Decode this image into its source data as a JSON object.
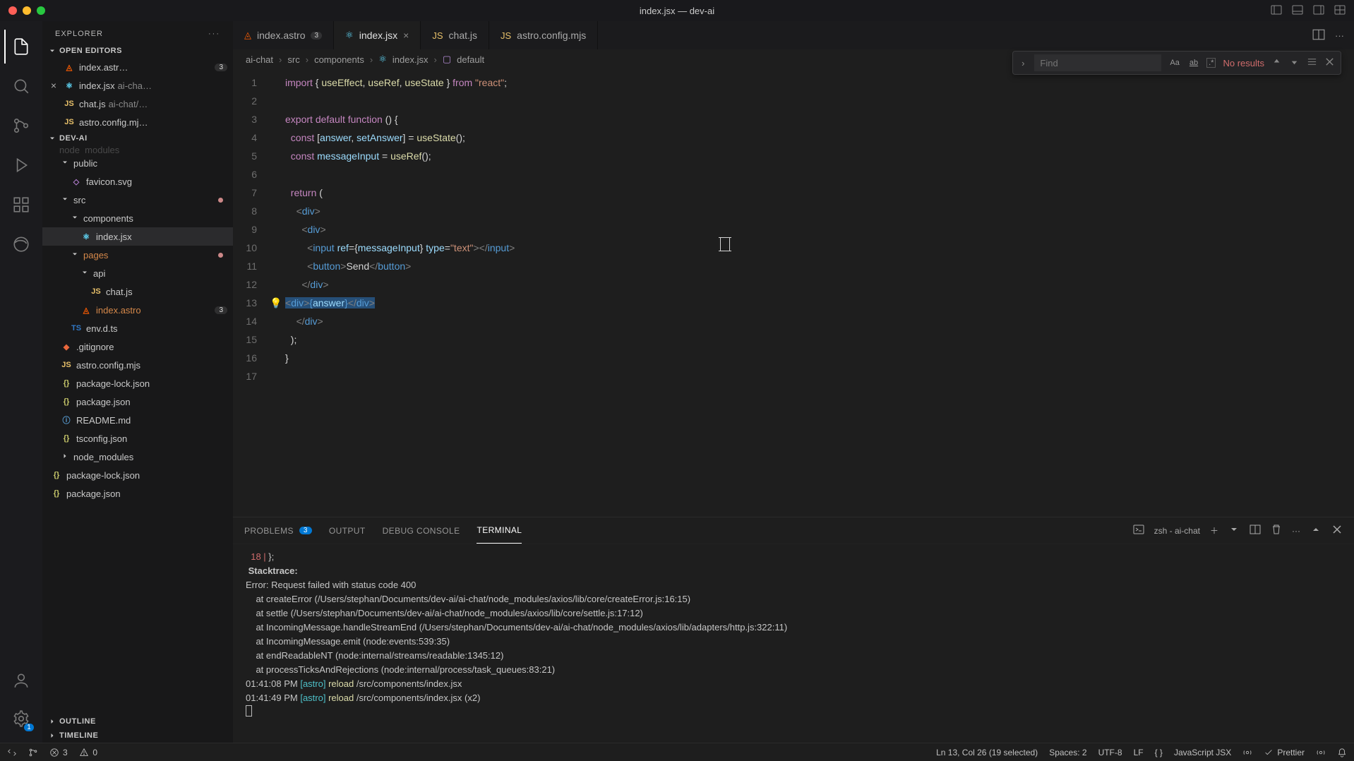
{
  "window": {
    "title": "index.jsx — dev-ai"
  },
  "explorer": {
    "title": "EXPLORER",
    "open_editors_label": "OPEN EDITORS",
    "project_label": "DEV-AI",
    "outline_label": "OUTLINE",
    "timeline_label": "TIMELINE",
    "open_editors": [
      {
        "name": "index.astr…",
        "icon": "astro",
        "badge": "3"
      },
      {
        "name": "index.jsx",
        "dim": "ai-cha…",
        "icon": "react",
        "close": true
      },
      {
        "name": "chat.js",
        "dim": "ai-chat/…",
        "icon": "js"
      },
      {
        "name": "astro.config.mj…",
        "icon": "js"
      }
    ],
    "tree": [
      {
        "depth": 1,
        "kind": "folder-open",
        "label": "public"
      },
      {
        "depth": 2,
        "kind": "file",
        "icon": "svg",
        "label": "favicon.svg"
      },
      {
        "depth": 1,
        "kind": "folder-open",
        "label": "src",
        "dot": true
      },
      {
        "depth": 2,
        "kind": "folder-open",
        "label": "components"
      },
      {
        "depth": 3,
        "kind": "file",
        "icon": "react",
        "label": "index.jsx",
        "selected": true
      },
      {
        "depth": 2,
        "kind": "folder-open",
        "label": "pages",
        "orange": true,
        "dot": true
      },
      {
        "depth": 3,
        "kind": "folder-open",
        "label": "api"
      },
      {
        "depth": 4,
        "kind": "file",
        "icon": "js",
        "label": "chat.js"
      },
      {
        "depth": 3,
        "kind": "file",
        "icon": "astro",
        "label": "index.astro",
        "orange": true,
        "badge": "3"
      },
      {
        "depth": 2,
        "kind": "file",
        "icon": "ts",
        "label": "env.d.ts"
      },
      {
        "depth": 1,
        "kind": "file",
        "icon": "git",
        "label": ".gitignore"
      },
      {
        "depth": 1,
        "kind": "file",
        "icon": "js",
        "label": "astro.config.mjs"
      },
      {
        "depth": 1,
        "kind": "file",
        "icon": "json",
        "label": "package-lock.json"
      },
      {
        "depth": 1,
        "kind": "file",
        "icon": "json",
        "label": "package.json"
      },
      {
        "depth": 1,
        "kind": "file",
        "icon": "info",
        "label": "README.md"
      },
      {
        "depth": 1,
        "kind": "file",
        "icon": "json",
        "label": "tsconfig.json"
      },
      {
        "depth": 1,
        "kind": "folder",
        "label": "node_modules"
      },
      {
        "depth": 0,
        "kind": "file",
        "icon": "json",
        "label": "package-lock.json"
      },
      {
        "depth": 0,
        "kind": "file",
        "icon": "json",
        "label": "package.json"
      }
    ]
  },
  "tabs": [
    {
      "icon": "astro",
      "label": "index.astro",
      "badge": "3",
      "active": false
    },
    {
      "icon": "react",
      "label": "index.jsx",
      "close": true,
      "active": true
    },
    {
      "icon": "js",
      "label": "chat.js",
      "active": false
    },
    {
      "icon": "js",
      "label": "astro.config.mjs",
      "active": false
    }
  ],
  "breadcrumb": [
    "ai-chat",
    "src",
    "components",
    "index.jsx",
    "default"
  ],
  "find": {
    "placeholder": "Find",
    "no_results": "No results",
    "case": "Aa",
    "word": "ab",
    "regex": ".*"
  },
  "code": {
    "lines": [
      "import { useEffect, useRef, useState } from \"react\";",
      "",
      "export default function () {",
      "  const [answer, setAnswer] = useState();",
      "  const messageInput = useRef();",
      "",
      "  return (",
      "    <div>",
      "      <div>",
      "        <input ref={messageInput} type=\"text\"></input>",
      "        <button>Send</button>",
      "      </div>",
      "      <div>{answer}</div>",
      "    </div>",
      "  );",
      "}",
      ""
    ],
    "highlight_line": 13
  },
  "panel": {
    "tabs": {
      "problems": "PROBLEMS",
      "problems_badge": "3",
      "output": "OUTPUT",
      "debug": "DEBUG CONSOLE",
      "terminal": "TERMINAL"
    },
    "shell_label": "zsh - ai-chat",
    "terminal_lines": [
      {
        "plain": "  18 | };",
        "red_prefix": true
      },
      {
        "bold": " Stacktrace:"
      },
      {
        "plain": "Error: Request failed with status code 400"
      },
      {
        "plain": "    at createError (/Users/stephan/Documents/dev-ai/ai-chat/node_modules/axios/lib/core/createError.js:16:15)"
      },
      {
        "plain": "    at settle (/Users/stephan/Documents/dev-ai/ai-chat/node_modules/axios/lib/core/settle.js:17:12)"
      },
      {
        "plain": "    at IncomingMessage.handleStreamEnd (/Users/stephan/Documents/dev-ai/ai-chat/node_modules/axios/lib/adapters/http.js:322:11)"
      },
      {
        "plain": "    at IncomingMessage.emit (node:events:539:35)"
      },
      {
        "plain": "    at endReadableNT (node:internal/streams/readable:1345:12)"
      },
      {
        "plain": "    at processTicksAndRejections (node:internal/process/task_queues:83:21)"
      },
      {
        "reload": true,
        "time": "01:41:08 PM",
        "tag": "[astro]",
        "action": "reload",
        "path": "/src/components/index.jsx"
      },
      {
        "reload": true,
        "time": "01:41:49 PM",
        "tag": "[astro]",
        "action": "reload",
        "path": "/src/components/index.jsx (x2)"
      }
    ]
  },
  "status": {
    "remote": "",
    "branch": "",
    "errors": "3",
    "warnings": "0",
    "cursor": "Ln 13, Col 26 (19 selected)",
    "spaces": "Spaces: 2",
    "encoding": "UTF-8",
    "eol": "LF",
    "braces": "{ }",
    "language": "JavaScript JSX",
    "prettier": "Prettier"
  },
  "activity_badge": "1"
}
